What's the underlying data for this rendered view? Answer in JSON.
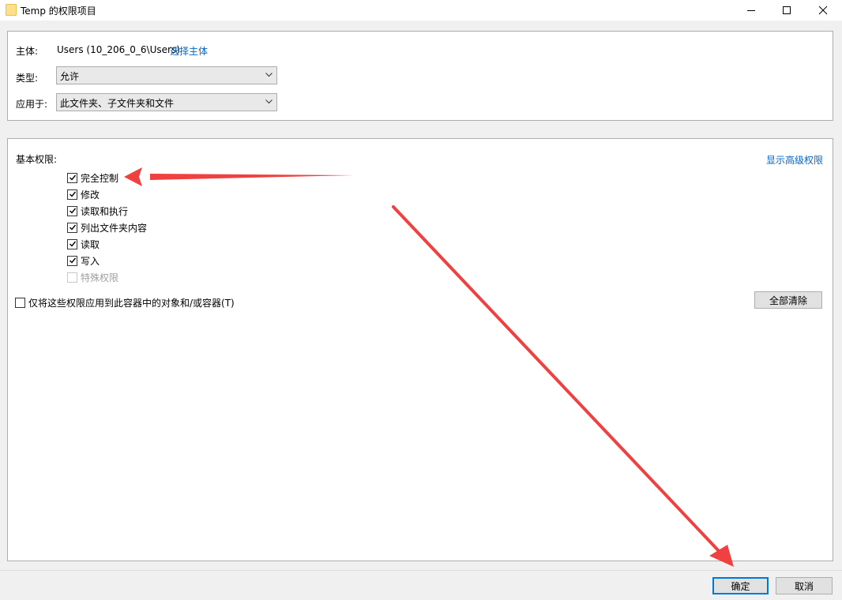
{
  "window": {
    "title": "Temp 的权限项目",
    "icon": "folder-icon"
  },
  "principal": {
    "label": "主体:",
    "value": "Users (10_206_0_6\\Users)",
    "select_link": "选择主体"
  },
  "type": {
    "label": "类型:",
    "value": "允许"
  },
  "applies_to": {
    "label": "应用于:",
    "value": "此文件夹、子文件夹和文件"
  },
  "basic_permissions": {
    "heading": "基本权限:",
    "advanced_link": "显示高级权限",
    "items": [
      {
        "label": "完全控制",
        "checked": true,
        "enabled": true
      },
      {
        "label": "修改",
        "checked": true,
        "enabled": true
      },
      {
        "label": "读取和执行",
        "checked": true,
        "enabled": true
      },
      {
        "label": "列出文件夹内容",
        "checked": true,
        "enabled": true
      },
      {
        "label": "读取",
        "checked": true,
        "enabled": true
      },
      {
        "label": "写入",
        "checked": true,
        "enabled": true
      },
      {
        "label": "特殊权限",
        "checked": false,
        "enabled": false
      }
    ]
  },
  "apply_only": {
    "label": "仅将这些权限应用到此容器中的对象和/或容器(T)",
    "checked": false
  },
  "clear_all_button": "全部清除",
  "footer": {
    "ok": "确定",
    "cancel": "取消"
  },
  "colors": {
    "link": "#0066cc",
    "annotation_arrow": "#f04040",
    "primary_button_border": "#0078d7"
  }
}
